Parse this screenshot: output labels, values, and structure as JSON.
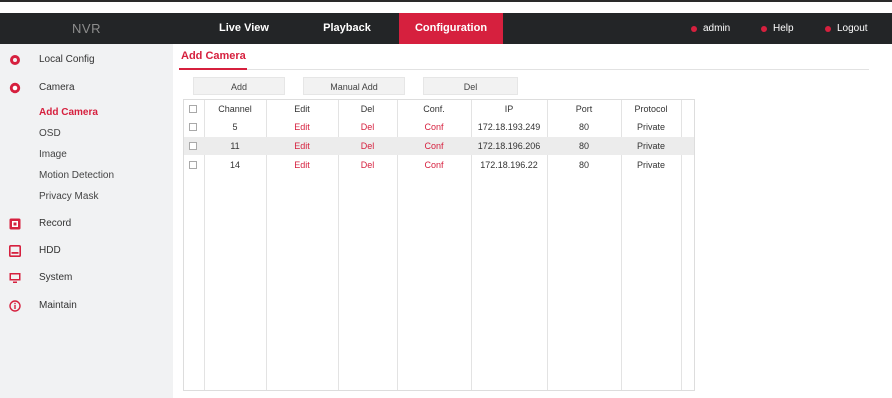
{
  "topbar": {
    "logo": "NVR",
    "nav": [
      {
        "label": "Live View",
        "active": false
      },
      {
        "label": "Playback",
        "active": false
      },
      {
        "label": "Configuration",
        "active": true
      }
    ],
    "user_menu": [
      "admin",
      "Help",
      "Logout"
    ],
    "accent_color": "#d6203e"
  },
  "sidebar": {
    "items": [
      {
        "label": "Local Config",
        "icon": "gear-icon"
      },
      {
        "label": "Camera",
        "icon": "camera-icon"
      },
      {
        "label": "Record",
        "icon": "record-icon"
      },
      {
        "label": "HDD",
        "icon": "hdd-icon"
      },
      {
        "label": "System",
        "icon": "monitor-icon"
      },
      {
        "label": "Maintain",
        "icon": "info-icon"
      }
    ],
    "camera_subitems": [
      "Add Camera",
      "OSD",
      "Image",
      "Motion Detection",
      "Privacy Mask"
    ],
    "active_subitem": "Add Camera"
  },
  "page": {
    "tab": "Add Camera",
    "buttons": {
      "add": "Add",
      "manual_add": "Manual Add",
      "del": "Del"
    }
  },
  "table": {
    "headers": [
      "Channel",
      "Edit",
      "Del",
      "Conf.",
      "IP",
      "Port",
      "Protocol"
    ],
    "rows": [
      {
        "channel": "5",
        "edit": "Edit",
        "del": "Del",
        "conf": "Conf",
        "ip": "172.18.193.249",
        "port": "80",
        "protocol": "Private"
      },
      {
        "channel": "11",
        "edit": "Edit",
        "del": "Del",
        "conf": "Conf",
        "ip": "172.18.196.206",
        "port": "80",
        "protocol": "Private"
      },
      {
        "channel": "14",
        "edit": "Edit",
        "del": "Del",
        "conf": "Conf",
        "ip": "172.18.196.22",
        "port": "80",
        "protocol": "Private"
      }
    ]
  }
}
